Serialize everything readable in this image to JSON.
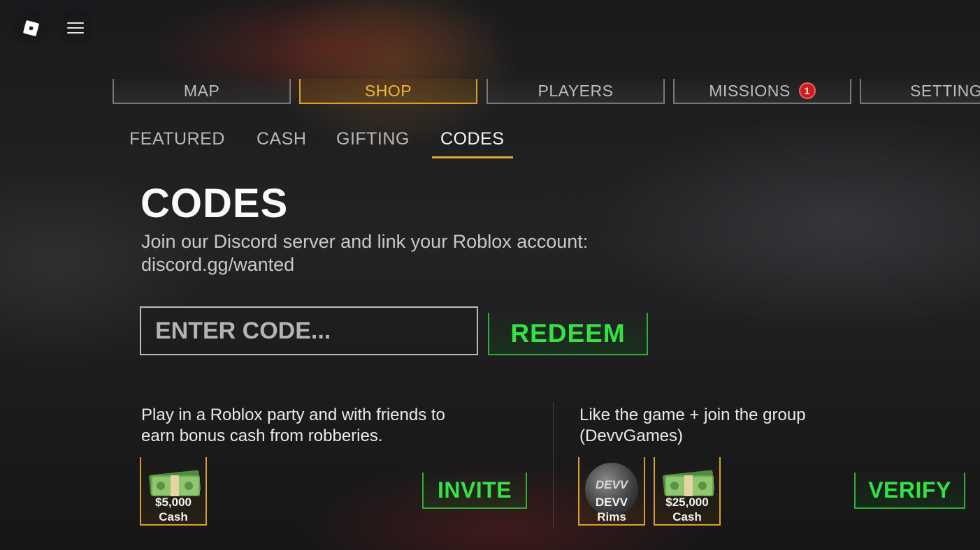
{
  "nav": {
    "tabs": [
      {
        "label": "MAP"
      },
      {
        "label": "SHOP"
      },
      {
        "label": "PLAYERS"
      },
      {
        "label": "MISSIONS",
        "badge": "1"
      },
      {
        "label": "SETTINGS"
      }
    ]
  },
  "shop": {
    "subtabs": [
      "FEATURED",
      "CASH",
      "GIFTING",
      "CODES"
    ]
  },
  "codes": {
    "title": "CODES",
    "description_line1": "Join our Discord server and link your Roblox account:",
    "description_line2": "discord.gg/wanted",
    "input_placeholder": "ENTER CODE...",
    "redeem_label": "REDEEM"
  },
  "promos": [
    {
      "text_line1": "Play in a Roblox party and with friends to",
      "text_line2": "earn bonus cash from robberies.",
      "rewards": [
        {
          "line1": "$5,000",
          "line2": "Cash",
          "icon": "cash-stack-icon"
        }
      ],
      "button": "INVITE"
    },
    {
      "text_line1": "Like the game + join the group",
      "text_line2": "(DevvGames)",
      "rewards": [
        {
          "line1": "DEVV",
          "line2": "Rims",
          "icon": "devv-rims-icon",
          "logo_text": "DEVV"
        },
        {
          "line1": "$25,000",
          "line2": "Cash",
          "icon": "cash-stack-icon"
        }
      ],
      "button": "VERIFY"
    }
  ],
  "colors": {
    "accent_gold": "#d9a12b",
    "accent_green": "#35e245",
    "badge_red": "#d11a1a"
  }
}
